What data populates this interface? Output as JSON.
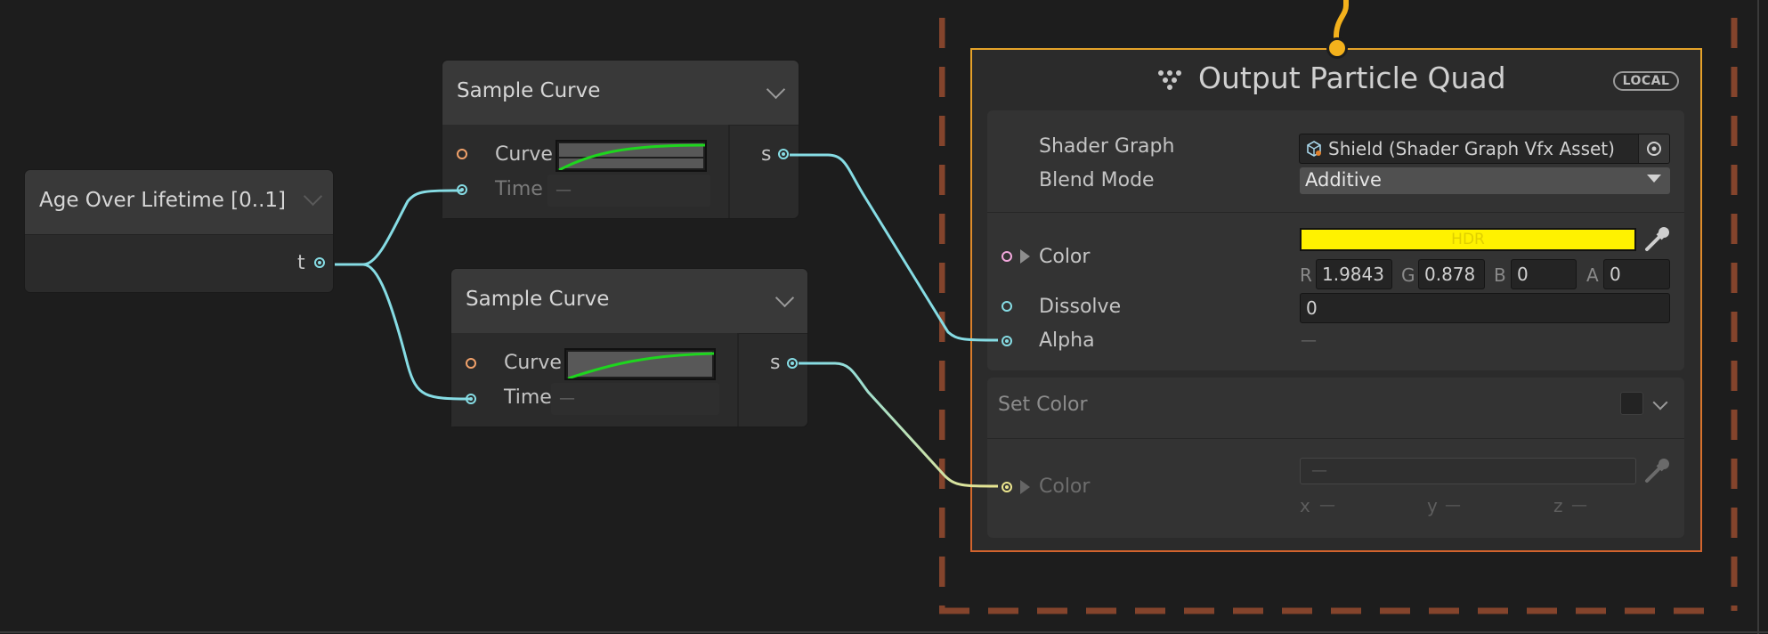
{
  "nodes": {
    "age": {
      "title": "Age Over Lifetime [0..1]",
      "output_label": "t"
    },
    "sample1": {
      "title": "Sample Curve",
      "curve_label": "Curve",
      "time_label": "Time",
      "time_value": "—",
      "output_label": "s"
    },
    "sample2": {
      "title": "Sample Curve",
      "curve_label": "Curve",
      "time_label": "Time",
      "time_value": "—",
      "output_label": "s"
    },
    "output": {
      "title": "Output Particle Quad",
      "badge": "LOCAL",
      "shader_graph_label": "Shader Graph",
      "shader_graph_value": "Shield (Shader Graph Vfx Asset)",
      "blend_mode_label": "Blend Mode",
      "blend_mode_value": "Additive",
      "color_label": "Color",
      "color_swatch_hex": "#FFF200",
      "color_hdr_text": "HDR",
      "r_label": "R",
      "r_value": "1.9843",
      "g_label": "G",
      "g_value": "0.878",
      "b_label": "B",
      "b_value": "0",
      "a_label": "A",
      "a_value": "0",
      "dissolve_label": "Dissolve",
      "dissolve_value": "0",
      "alpha_label": "Alpha",
      "alpha_value": "—"
    },
    "set_color": {
      "title": "Set Color",
      "color_label": "Color",
      "swatch_value": "—",
      "x_label": "x",
      "x_value": "—",
      "y_label": "y",
      "y_value": "—",
      "z_label": "z",
      "z_value": "—"
    }
  },
  "colors": {
    "wire_float": "#86dce4",
    "wire_yellow": "#ebe58e",
    "curve_green": "#1ed61e",
    "frame_border": "#84442c",
    "output_border": "#e6a329"
  }
}
